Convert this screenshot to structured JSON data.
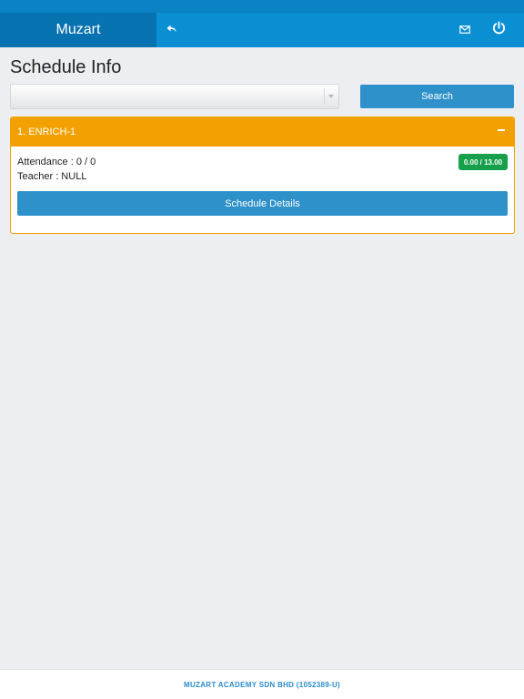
{
  "app": {
    "brand": "Muzart"
  },
  "navbar": {
    "icons": [
      "back-arrow-icon",
      "mail-icon",
      "power-icon"
    ],
    "color": "#0a8fd2",
    "brand_bg": "#0772b0"
  },
  "page": {
    "title": "Schedule Info"
  },
  "filter": {
    "selected": "",
    "search_label": "Search"
  },
  "schedule": {
    "items": [
      {
        "title": "1. ENRICH-1",
        "attendance": "Attendance : 0 / 0",
        "teacher": "Teacher : NULL",
        "hours_badge": "0.00 / 13.00",
        "details_label": "Schedule Details",
        "header_color": "#f2a100",
        "badge_color": "#17a04c"
      }
    ]
  },
  "footer": {
    "text": "MUZART ACADEMY SDN BHD (1052389-U)"
  }
}
